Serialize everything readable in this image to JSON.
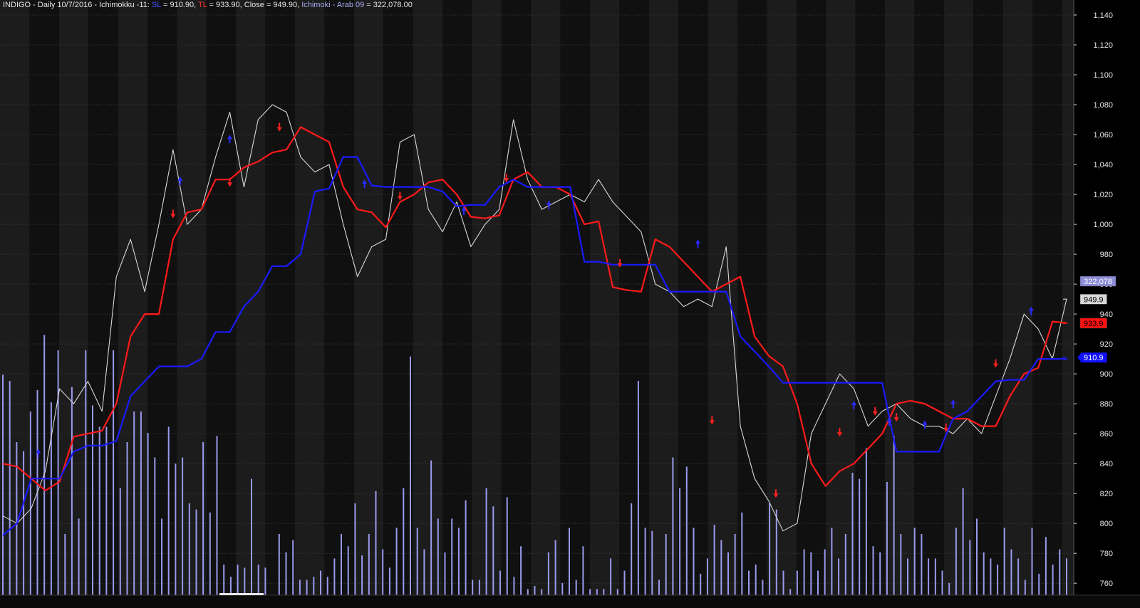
{
  "header": {
    "title": "INDIGO - Daily 10/7/2016 - Ichimokku -11: ",
    "sl_label": "SL",
    "sl_text": " = 910.90, ",
    "tl_label": "TL",
    "tl_text": " = 933.90, Close = 949.90, ",
    "vol_label": "Ichimoki - Arab 09",
    "vol_text": " = 322,078.00"
  },
  "colors": {
    "background": "#000000",
    "band_light": "#1c1c1c",
    "band_dark": "#101010",
    "grid": "#3a3a3a",
    "close": "#d8d8d8",
    "tl": "#ff1a1a",
    "sl": "#1a1aff",
    "volume": "#9a9aee",
    "axis_text": "#e6e6e6"
  },
  "chart_data": {
    "type": "line",
    "ylim": [
      752,
      1150
    ],
    "yticks": [
      "760",
      "780",
      "800",
      "820",
      "840",
      "860",
      "880",
      "900",
      "920",
      "940",
      "960",
      "980",
      "1,000",
      "1,020",
      "1,040",
      "1,060",
      "1,080",
      "1,100",
      "1,120",
      "1,140"
    ],
    "ytick_values": [
      760,
      780,
      800,
      820,
      840,
      860,
      880,
      900,
      920,
      940,
      960,
      980,
      1000,
      1020,
      1040,
      1060,
      1080,
      1100,
      1120,
      1140
    ],
    "xlim": [
      0,
      150
    ],
    "series": [
      {
        "name": "Close",
        "key": "close",
        "x": [
          0,
          2,
          4,
          6,
          8,
          10,
          12,
          14,
          16,
          18,
          20,
          22,
          24,
          26,
          28,
          30,
          32,
          34,
          36,
          38,
          40,
          42,
          44,
          46,
          48,
          50,
          52,
          54,
          56,
          58,
          60,
          62,
          64,
          66,
          68,
          70,
          72,
          74,
          76,
          78,
          80,
          82,
          84,
          86,
          88,
          90,
          92,
          94,
          96,
          98,
          100,
          102,
          104,
          106,
          108,
          110,
          112,
          114,
          116,
          118,
          120,
          122,
          124,
          126,
          128,
          130,
          132,
          134,
          136,
          138,
          140,
          142,
          144,
          146,
          148,
          150
        ],
        "y": [
          805,
          800,
          810,
          835,
          890,
          880,
          895,
          875,
          965,
          990,
          955,
          1000,
          1050,
          1000,
          1010,
          1045,
          1075,
          1025,
          1070,
          1080,
          1075,
          1045,
          1035,
          1040,
          1000,
          965,
          985,
          990,
          1055,
          1060,
          1010,
          995,
          1015,
          985,
          1000,
          1010,
          1070,
          1030,
          1010,
          1015,
          1020,
          1015,
          1030,
          1015,
          1005,
          995,
          960,
          955,
          945,
          950,
          945,
          985,
          865,
          830,
          815,
          795,
          800,
          860,
          880,
          900,
          890,
          865,
          875,
          880,
          870,
          865,
          865,
          860,
          870,
          860,
          885,
          910,
          940,
          930,
          910,
          950
        ],
        "x_end": 149.5,
        "y_end": 949.9
      },
      {
        "name": "TL",
        "key": "tl",
        "x": [
          0,
          2,
          4,
          6,
          8,
          10,
          12,
          14,
          16,
          18,
          20,
          22,
          24,
          26,
          28,
          30,
          32,
          34,
          36,
          38,
          40,
          42,
          44,
          46,
          48,
          50,
          52,
          54,
          56,
          58,
          60,
          62,
          64,
          66,
          68,
          70,
          72,
          74,
          76,
          78,
          80,
          82,
          84,
          86,
          88,
          90,
          92,
          94,
          96,
          98,
          100,
          102,
          104,
          106,
          108,
          110,
          112,
          114,
          116,
          118,
          120,
          122,
          124,
          126,
          128,
          130,
          132,
          134,
          136,
          138,
          140,
          142,
          144,
          146,
          148,
          150
        ],
        "y": [
          840,
          838,
          830,
          822,
          828,
          858,
          860,
          862,
          880,
          925,
          940,
          940,
          990,
          1008,
          1010,
          1030,
          1030,
          1038,
          1042,
          1048,
          1050,
          1065,
          1060,
          1055,
          1025,
          1010,
          1008,
          998,
          1015,
          1020,
          1028,
          1030,
          1020,
          1005,
          1004,
          1006,
          1030,
          1035,
          1025,
          1025,
          1020,
          1000,
          1002,
          958,
          956,
          955,
          990,
          985,
          975,
          965,
          955,
          960,
          965,
          925,
          912,
          905,
          880,
          840,
          825,
          835,
          840,
          850,
          860,
          880,
          882,
          880,
          875,
          870,
          870,
          865,
          865,
          885,
          900,
          904,
          935,
          934
        ],
        "x_end": 149.5,
        "y_end": 933.9
      },
      {
        "name": "SL",
        "key": "sl",
        "x": [
          0,
          2,
          4,
          6,
          8,
          10,
          12,
          14,
          16,
          18,
          20,
          22,
          24,
          26,
          28,
          30,
          32,
          34,
          36,
          38,
          40,
          42,
          44,
          46,
          48,
          50,
          52,
          54,
          56,
          58,
          60,
          62,
          64,
          66,
          68,
          70,
          72,
          74,
          76,
          78,
          80,
          82,
          84,
          86,
          88,
          90,
          92,
          94,
          96,
          98,
          100,
          102,
          104,
          106,
          108,
          110,
          112,
          114,
          116,
          118,
          120,
          122,
          124,
          126,
          128,
          130,
          132,
          134,
          136,
          138,
          140,
          142,
          144,
          146,
          148,
          150
        ],
        "y": [
          792,
          800,
          830,
          830,
          830,
          848,
          852,
          852,
          855,
          885,
          895,
          905,
          905,
          905,
          910,
          928,
          928,
          945,
          955,
          972,
          972,
          980,
          1022,
          1024,
          1045,
          1045,
          1026,
          1025,
          1025,
          1025,
          1025,
          1022,
          1012,
          1013,
          1013,
          1025,
          1030,
          1025,
          1025,
          1025,
          1025,
          975,
          975,
          973,
          973,
          973,
          973,
          955,
          955,
          955,
          955,
          955,
          925,
          915,
          905,
          894,
          894,
          894,
          894,
          894,
          894,
          894,
          894,
          848,
          848,
          848,
          848,
          870,
          875,
          885,
          895,
          896,
          896,
          910,
          910,
          910
        ],
        "x_end": 149.5,
        "y_end": 910.9
      }
    ],
    "volume": {
      "name": "Ichimoki - Arab 09",
      "range": [
        0,
        465000
      ],
      "heights": [
        72,
        70,
        50,
        47,
        60,
        67,
        85,
        63,
        80,
        20,
        68,
        25,
        80,
        62,
        55,
        55,
        80,
        35,
        50,
        60,
        60,
        53,
        45,
        25,
        55,
        43,
        45,
        30,
        28,
        50,
        27,
        52,
        10,
        6,
        10,
        9,
        38,
        10,
        9,
        0,
        20,
        14,
        18,
        5,
        5,
        6,
        8,
        6,
        12,
        20,
        16,
        30,
        13,
        20,
        34,
        15,
        9,
        22,
        35,
        78,
        22,
        15,
        44,
        25,
        14,
        25,
        22,
        31,
        5,
        5,
        35,
        29,
        8,
        32,
        6,
        16,
        2,
        3,
        2,
        14,
        18,
        4,
        22,
        5,
        16,
        2,
        2,
        2,
        12,
        2,
        8,
        30,
        70,
        22,
        21,
        5,
        20,
        45,
        35,
        42,
        22,
        7,
        12,
        23,
        18,
        14,
        20,
        27,
        8,
        10,
        5,
        30,
        28,
        8,
        2,
        8,
        15,
        14,
        8,
        15,
        22,
        12,
        20,
        40,
        38,
        48,
        16,
        14,
        37,
        52,
        20,
        12,
        22,
        20,
        12,
        12,
        8,
        4,
        22,
        35,
        18,
        25,
        14,
        12,
        10,
        22,
        15,
        12,
        5,
        22,
        7,
        19,
        10,
        15,
        12
      ],
      "label": "322,078"
    },
    "up_arrows": [
      {
        "x": 5,
        "y": 848
      },
      {
        "x": 25,
        "y": 1030
      },
      {
        "x": 32,
        "y": 1058
      },
      {
        "x": 51,
        "y": 1028
      },
      {
        "x": 65,
        "y": 1010
      },
      {
        "x": 77,
        "y": 1014
      },
      {
        "x": 98,
        "y": 988
      },
      {
        "x": 120,
        "y": 880
      },
      {
        "x": 125,
        "y": 869
      },
      {
        "x": 130,
        "y": 867
      },
      {
        "x": 134,
        "y": 881
      },
      {
        "x": 145,
        "y": 943
      }
    ],
    "down_arrows": [
      {
        "x": 24,
        "y": 1006
      },
      {
        "x": 32,
        "y": 1027
      },
      {
        "x": 39,
        "y": 1064
      },
      {
        "x": 56,
        "y": 1018
      },
      {
        "x": 71,
        "y": 1030
      },
      {
        "x": 87,
        "y": 973
      },
      {
        "x": 100,
        "y": 868
      },
      {
        "x": 109,
        "y": 819
      },
      {
        "x": 118,
        "y": 860
      },
      {
        "x": 123,
        "y": 874
      },
      {
        "x": 126,
        "y": 870
      },
      {
        "x": 133,
        "y": 863
      },
      {
        "x": 140,
        "y": 906
      }
    ],
    "last_value_labels": [
      {
        "text": "322,078",
        "key": "volume"
      },
      {
        "text": "949.9",
        "key": "close"
      },
      {
        "text": "933.9",
        "key": "tl"
      },
      {
        "text": "910.9",
        "key": "sl"
      }
    ]
  }
}
